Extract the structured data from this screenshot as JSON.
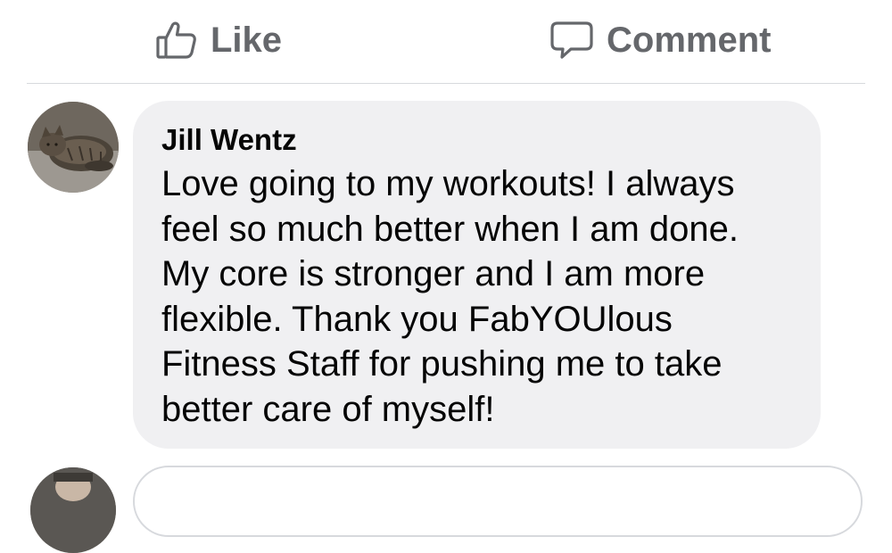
{
  "actions": {
    "like_label": "Like",
    "like_icon": "thumbs-up-icon",
    "comment_label": "Comment",
    "comment_icon": "speech-bubble-icon"
  },
  "comment": {
    "author": "Jill Wentz",
    "text": "Love going to my workouts! I always\nfeel so much better when I am done.\nMy core is stronger and I am more\nflexible. Thank you FabYOUlous\nFitness Staff for pushing me to take\nbetter care of myself!"
  },
  "colors": {
    "action_text": "#65676b",
    "bubble_bg": "#f0f0f2",
    "divider": "#d7d9dd",
    "text": "#050505"
  }
}
